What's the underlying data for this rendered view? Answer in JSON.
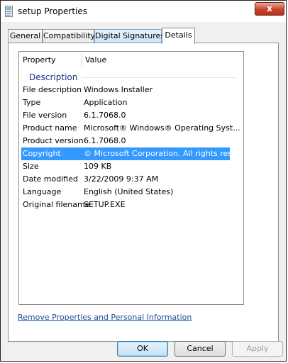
{
  "window": {
    "title": "setup Properties",
    "close_label": "x"
  },
  "tabs": [
    {
      "label": "General"
    },
    {
      "label": "Compatibility"
    },
    {
      "label": "Digital Signatures"
    },
    {
      "label": "Details"
    }
  ],
  "table": {
    "col_property": "Property",
    "col_value": "Value",
    "group": "Description",
    "rows": [
      {
        "key": "File description",
        "value": "Windows Installer"
      },
      {
        "key": "Type",
        "value": "Application"
      },
      {
        "key": "File version",
        "value": "6.1.7068.0"
      },
      {
        "key": "Product name",
        "value": "Microsoft® Windows® Operating Syst..."
      },
      {
        "key": "Product version",
        "value": "6.1.7068.0"
      },
      {
        "key": "Copyright",
        "value": "© Microsoft Corporation. All rights res..."
      },
      {
        "key": "Size",
        "value": "109 KB"
      },
      {
        "key": "Date modified",
        "value": "3/22/2009 9:37 AM"
      },
      {
        "key": "Language",
        "value": "English (United States)"
      },
      {
        "key": "Original filename",
        "value": "SETUP.EXE"
      }
    ]
  },
  "link": "Remove Properties and Personal Information",
  "buttons": {
    "ok": "OK",
    "cancel": "Cancel",
    "apply": "Apply"
  }
}
